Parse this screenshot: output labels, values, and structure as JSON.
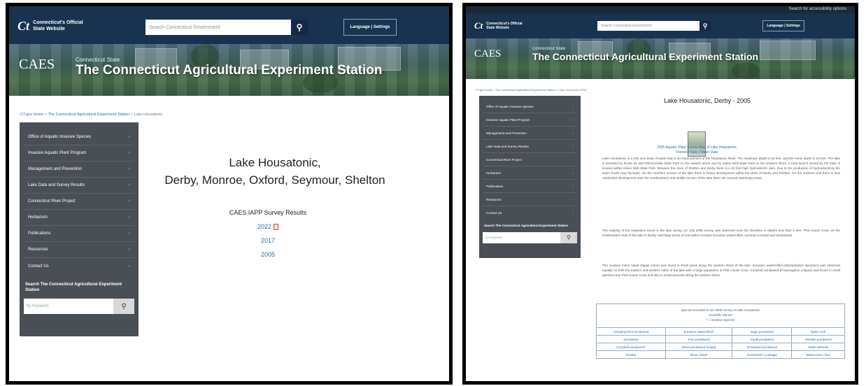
{
  "left": {
    "gov_line1": "Connecticut's Official",
    "gov_line2": "State Website",
    "search_placeholder": "Search Connecticut Government",
    "lang_button": "Language | Settings",
    "caes_logo": "CAES",
    "site_sub": "Connecticut State",
    "site_title": "The Connecticut Agricultural Experiment Station",
    "breadcrumb": [
      "CT.gov Home",
      "The Connecticut Agricultural Experiment Station",
      "Lake Housatonic"
    ],
    "nav": [
      "Office of Aquatic Invasive Species",
      "Invasive Aquatic Plant Program",
      "Management and Prevention",
      "Lake Data and Survey Results",
      "Connecticut River Project",
      "Herbarium",
      "Publications",
      "Resources",
      "Contact Us"
    ],
    "side_search_label": "Search The Connecticut Agricultural Experiment Station",
    "side_search_placeholder": "by Keyword",
    "lake_line1": "Lake Housatonic,",
    "lake_line2": "Derby, Monroe, Oxford, Seymour, Shelton",
    "survey_heading": "CAES IAPP Survey Results",
    "years": [
      "2022",
      "2017",
      "2005"
    ]
  },
  "right": {
    "top_link": "Search for accessibility options",
    "gov_line1": "Connecticut's Official",
    "gov_line2": "State Website",
    "search_placeholder": "Search Connecticut Government",
    "lang_button": "Language | Settings",
    "caes_logo": "CAES",
    "site_sub": "Connecticut State",
    "site_title": "The Connecticut Agricultural Experiment Station",
    "breadcrumb": [
      "CT.gov Home",
      "The Connecticut Agricultural Experiment Station",
      "Lake Housatonic 2005"
    ],
    "nav": [
      "Office of Aquatic Invasive Species",
      "Invasive Aquatic Plant Program",
      "Management and Prevention",
      "Lake Data and Survey Results",
      "Connecticut River Project",
      "Herbarium",
      "Publications",
      "Resources",
      "Contact Us"
    ],
    "side_search_label": "Search The Connecticut Agricultural Experiment Station",
    "side_search_placeholder": "by Keyword",
    "page_title": "Lake Housatonic, Derby - 2005",
    "map_link": "2005 Aquatic Plant Survey Map of Lake Housatonic",
    "transect_link": "Transect Data",
    "water_link": "Water Data",
    "para1": "Lake Housatonic is a 328 acre body of water that is an impoundment of the Housatonic River. The maximum depth is 24 feet, and the mean depth is 10 feet. The lake is bounded by Route 34 and Osbornedale State Park on the eastern shore and by Indian Well State Park on the western shore. A boat launch owned by the state is located within Indian Well State Park. Between the cities of Shelton and Derby there is a 20 foot high hydroelectric dam. Due to the production of hydroelectricity the water levels may fluctuate. On the southern section of the lake there is heavy development within the cities of Derby and Shelton. On the northern end there is less residential development near the southwestern and middle section of the lake there are several swimming areas.",
    "para2": "The majority of the vegetation found in the lake during our July 2005 survey was observed near the shoreline in depths less than 5 feet. Pink House Cove, on the southeastern side of the lake in Derby, had large areas of non-native invasive Eurasian watermilfoil, common coontail and duckweeds.",
    "para3": "The invasive minor naiad (Najas minor) was found in small areas along the western shore of the lake. Eurasian watermilfoil (Myriophyllum spicatum) was observed equally on both the eastern and western sides of the lake with a large population in Pink House Cove. Curlyleaf pondweed (Potamogeton crispus) was found in small patches near Pink House Cove and also in small amounts along the western shore.",
    "table_head1": "Species recorded in our 2005 survey of Lake Housatonic",
    "table_head2": "Scientific Names",
    "table_head3": "* = Invasive Species",
    "species": [
      [
        "Creeping bent pondweed",
        "Eurasian watermilfoil*",
        "Sago pondweed",
        "Spike rush"
      ],
      [
        "Duckweed",
        "Fern pondweed",
        "Small pondweed",
        "Variable pondweed"
      ],
      [
        "Curlyleaf pondweed*",
        "Minor pondweed (naiad)",
        "Duckweed pondweed",
        "Water-plantain"
      ],
      [
        "Elodea",
        "Minor naiad*",
        "Duckweed / Ludwigia",
        "Watercress / Nux"
      ]
    ]
  }
}
